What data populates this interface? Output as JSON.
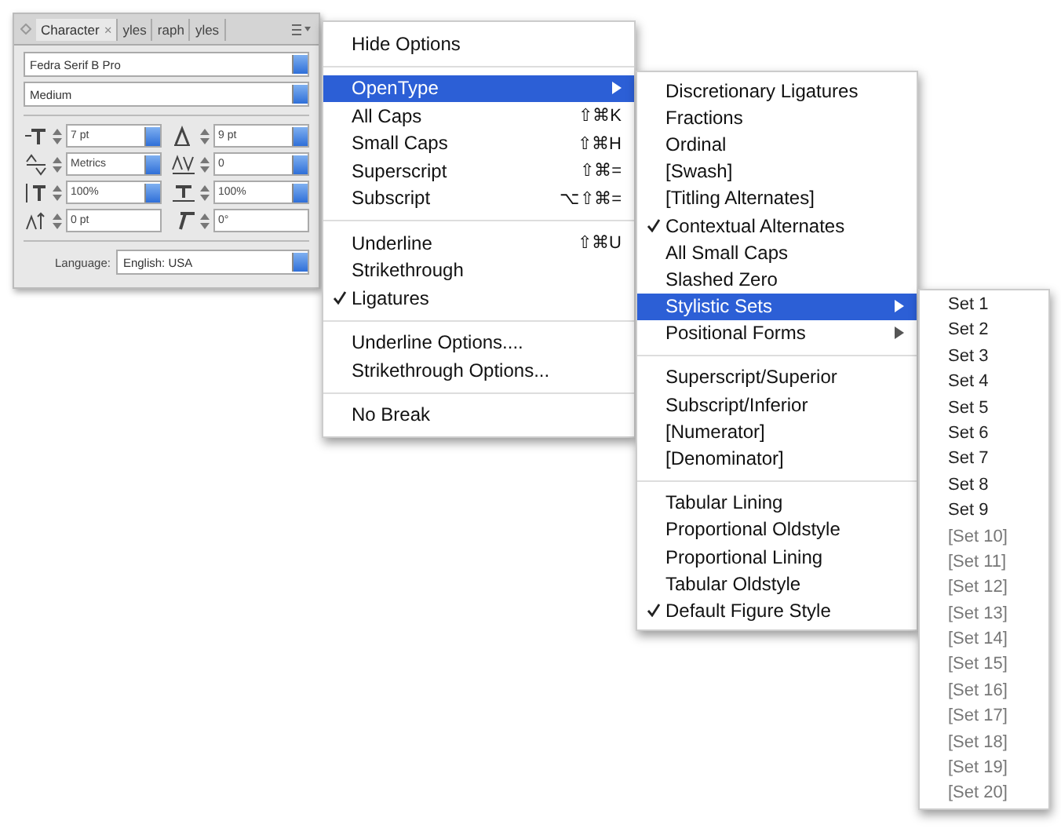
{
  "panel": {
    "tabs": [
      {
        "label": "Character",
        "selected": true,
        "close": "×"
      },
      {
        "label": "yles",
        "selected": false
      },
      {
        "label": "raph",
        "selected": false
      },
      {
        "label": "yles",
        "selected": false
      }
    ],
    "font_family": "Fedra Serif B Pro",
    "font_style": "Medium",
    "metrics": [
      {
        "kind": "dropdown",
        "value": "7 pt"
      },
      {
        "kind": "dropdown",
        "value": "9 pt"
      },
      {
        "kind": "dropdown",
        "value": "Metrics"
      },
      {
        "kind": "dropdown",
        "value": "0"
      },
      {
        "kind": "dropdown",
        "value": "100%"
      },
      {
        "kind": "dropdown",
        "value": "100%"
      },
      {
        "kind": "field",
        "value": "0 pt"
      },
      {
        "kind": "field",
        "value": "0°"
      }
    ],
    "language_label": "Language:",
    "language": "English: USA"
  },
  "menu": {
    "items": [
      {
        "kind": "item",
        "label": "Hide Options",
        "selected": false,
        "checked": false
      },
      {
        "kind": "separator"
      },
      {
        "kind": "item",
        "label": "OpenType",
        "selected": true,
        "checked": false,
        "submenu": true,
        "children": [
          {
            "kind": "item",
            "label": "Discretionary Ligatures",
            "selected": false,
            "checked": false
          },
          {
            "kind": "item",
            "label": "Fractions",
            "selected": false,
            "checked": false
          },
          {
            "kind": "item",
            "label": "Ordinal",
            "selected": false,
            "checked": false
          },
          {
            "kind": "item",
            "label": "[Swash]",
            "selected": false,
            "checked": false
          },
          {
            "kind": "item",
            "label": "[Titling Alternates]",
            "selected": false,
            "checked": false
          },
          {
            "kind": "item",
            "label": "Contextual Alternates",
            "selected": false,
            "checked": true
          },
          {
            "kind": "item",
            "label": "All Small Caps",
            "selected": false,
            "checked": false
          },
          {
            "kind": "item",
            "label": "Slashed Zero",
            "selected": false,
            "checked": false
          },
          {
            "kind": "item",
            "label": "Stylistic Sets",
            "selected": true,
            "checked": false,
            "submenu": true,
            "children": [
              {
                "kind": "item",
                "label": "Set 1",
                "disabled": false
              },
              {
                "kind": "item",
                "label": "Set 2",
                "disabled": false
              },
              {
                "kind": "item",
                "label": "Set 3",
                "disabled": false
              },
              {
                "kind": "item",
                "label": "Set 4",
                "disabled": false
              },
              {
                "kind": "item",
                "label": "Set 5",
                "disabled": false
              },
              {
                "kind": "item",
                "label": "Set 6",
                "disabled": false
              },
              {
                "kind": "item",
                "label": "Set 7",
                "disabled": false
              },
              {
                "kind": "item",
                "label": "Set 8",
                "disabled": false
              },
              {
                "kind": "item",
                "label": "Set 9",
                "disabled": false
              },
              {
                "kind": "item",
                "label": "[Set 10]",
                "disabled": true
              },
              {
                "kind": "item",
                "label": "[Set 11]",
                "disabled": true
              },
              {
                "kind": "item",
                "label": "[Set 12]",
                "disabled": true
              },
              {
                "kind": "item",
                "label": "[Set 13]",
                "disabled": true
              },
              {
                "kind": "item",
                "label": "[Set 14]",
                "disabled": true
              },
              {
                "kind": "item",
                "label": "[Set 15]",
                "disabled": true
              },
              {
                "kind": "item",
                "label": "[Set 16]",
                "disabled": true
              },
              {
                "kind": "item",
                "label": "[Set 17]",
                "disabled": true
              },
              {
                "kind": "item",
                "label": "[Set 18]",
                "disabled": true
              },
              {
                "kind": "item",
                "label": "[Set 19]",
                "disabled": true
              },
              {
                "kind": "item",
                "label": "[Set 20]",
                "disabled": true
              }
            ]
          },
          {
            "kind": "item",
            "label": "Positional Forms",
            "selected": false,
            "checked": false,
            "submenu": true
          },
          {
            "kind": "separator"
          },
          {
            "kind": "item",
            "label": "Superscript/Superior",
            "selected": false,
            "checked": false
          },
          {
            "kind": "item",
            "label": "Subscript/Inferior",
            "selected": false,
            "checked": false
          },
          {
            "kind": "item",
            "label": "[Numerator]",
            "selected": false,
            "checked": false
          },
          {
            "kind": "item",
            "label": "[Denominator]",
            "selected": false,
            "checked": false
          },
          {
            "kind": "separator"
          },
          {
            "kind": "item",
            "label": "Tabular Lining",
            "selected": false,
            "checked": false
          },
          {
            "kind": "item",
            "label": "Proportional Oldstyle",
            "selected": false,
            "checked": false
          },
          {
            "kind": "item",
            "label": "Proportional Lining",
            "selected": false,
            "checked": false
          },
          {
            "kind": "item",
            "label": "Tabular Oldstyle",
            "selected": false,
            "checked": false
          },
          {
            "kind": "item",
            "label": "Default Figure Style",
            "selected": false,
            "checked": true
          }
        ]
      },
      {
        "kind": "item",
        "label": "All Caps",
        "shortcut": "⇧⌘K",
        "selected": false,
        "checked": false
      },
      {
        "kind": "item",
        "label": "Small Caps",
        "shortcut": "⇧⌘H",
        "selected": false,
        "checked": false
      },
      {
        "kind": "item",
        "label": "Superscript",
        "shortcut": "⇧⌘=",
        "selected": false,
        "checked": false
      },
      {
        "kind": "item",
        "label": "Subscript",
        "shortcut": "⌥⇧⌘=",
        "selected": false,
        "checked": false
      },
      {
        "kind": "separator"
      },
      {
        "kind": "item",
        "label": "Underline",
        "shortcut": "⇧⌘U",
        "selected": false,
        "checked": false
      },
      {
        "kind": "item",
        "label": "Strikethrough",
        "selected": false,
        "checked": false
      },
      {
        "kind": "item",
        "label": "Ligatures",
        "selected": false,
        "checked": true
      },
      {
        "kind": "separator"
      },
      {
        "kind": "item",
        "label": "Underline Options....",
        "selected": false,
        "checked": false
      },
      {
        "kind": "item",
        "label": "Strikethrough Options...",
        "selected": false,
        "checked": false
      },
      {
        "kind": "separator"
      },
      {
        "kind": "item",
        "label": "No Break",
        "selected": false,
        "checked": false
      }
    ]
  }
}
